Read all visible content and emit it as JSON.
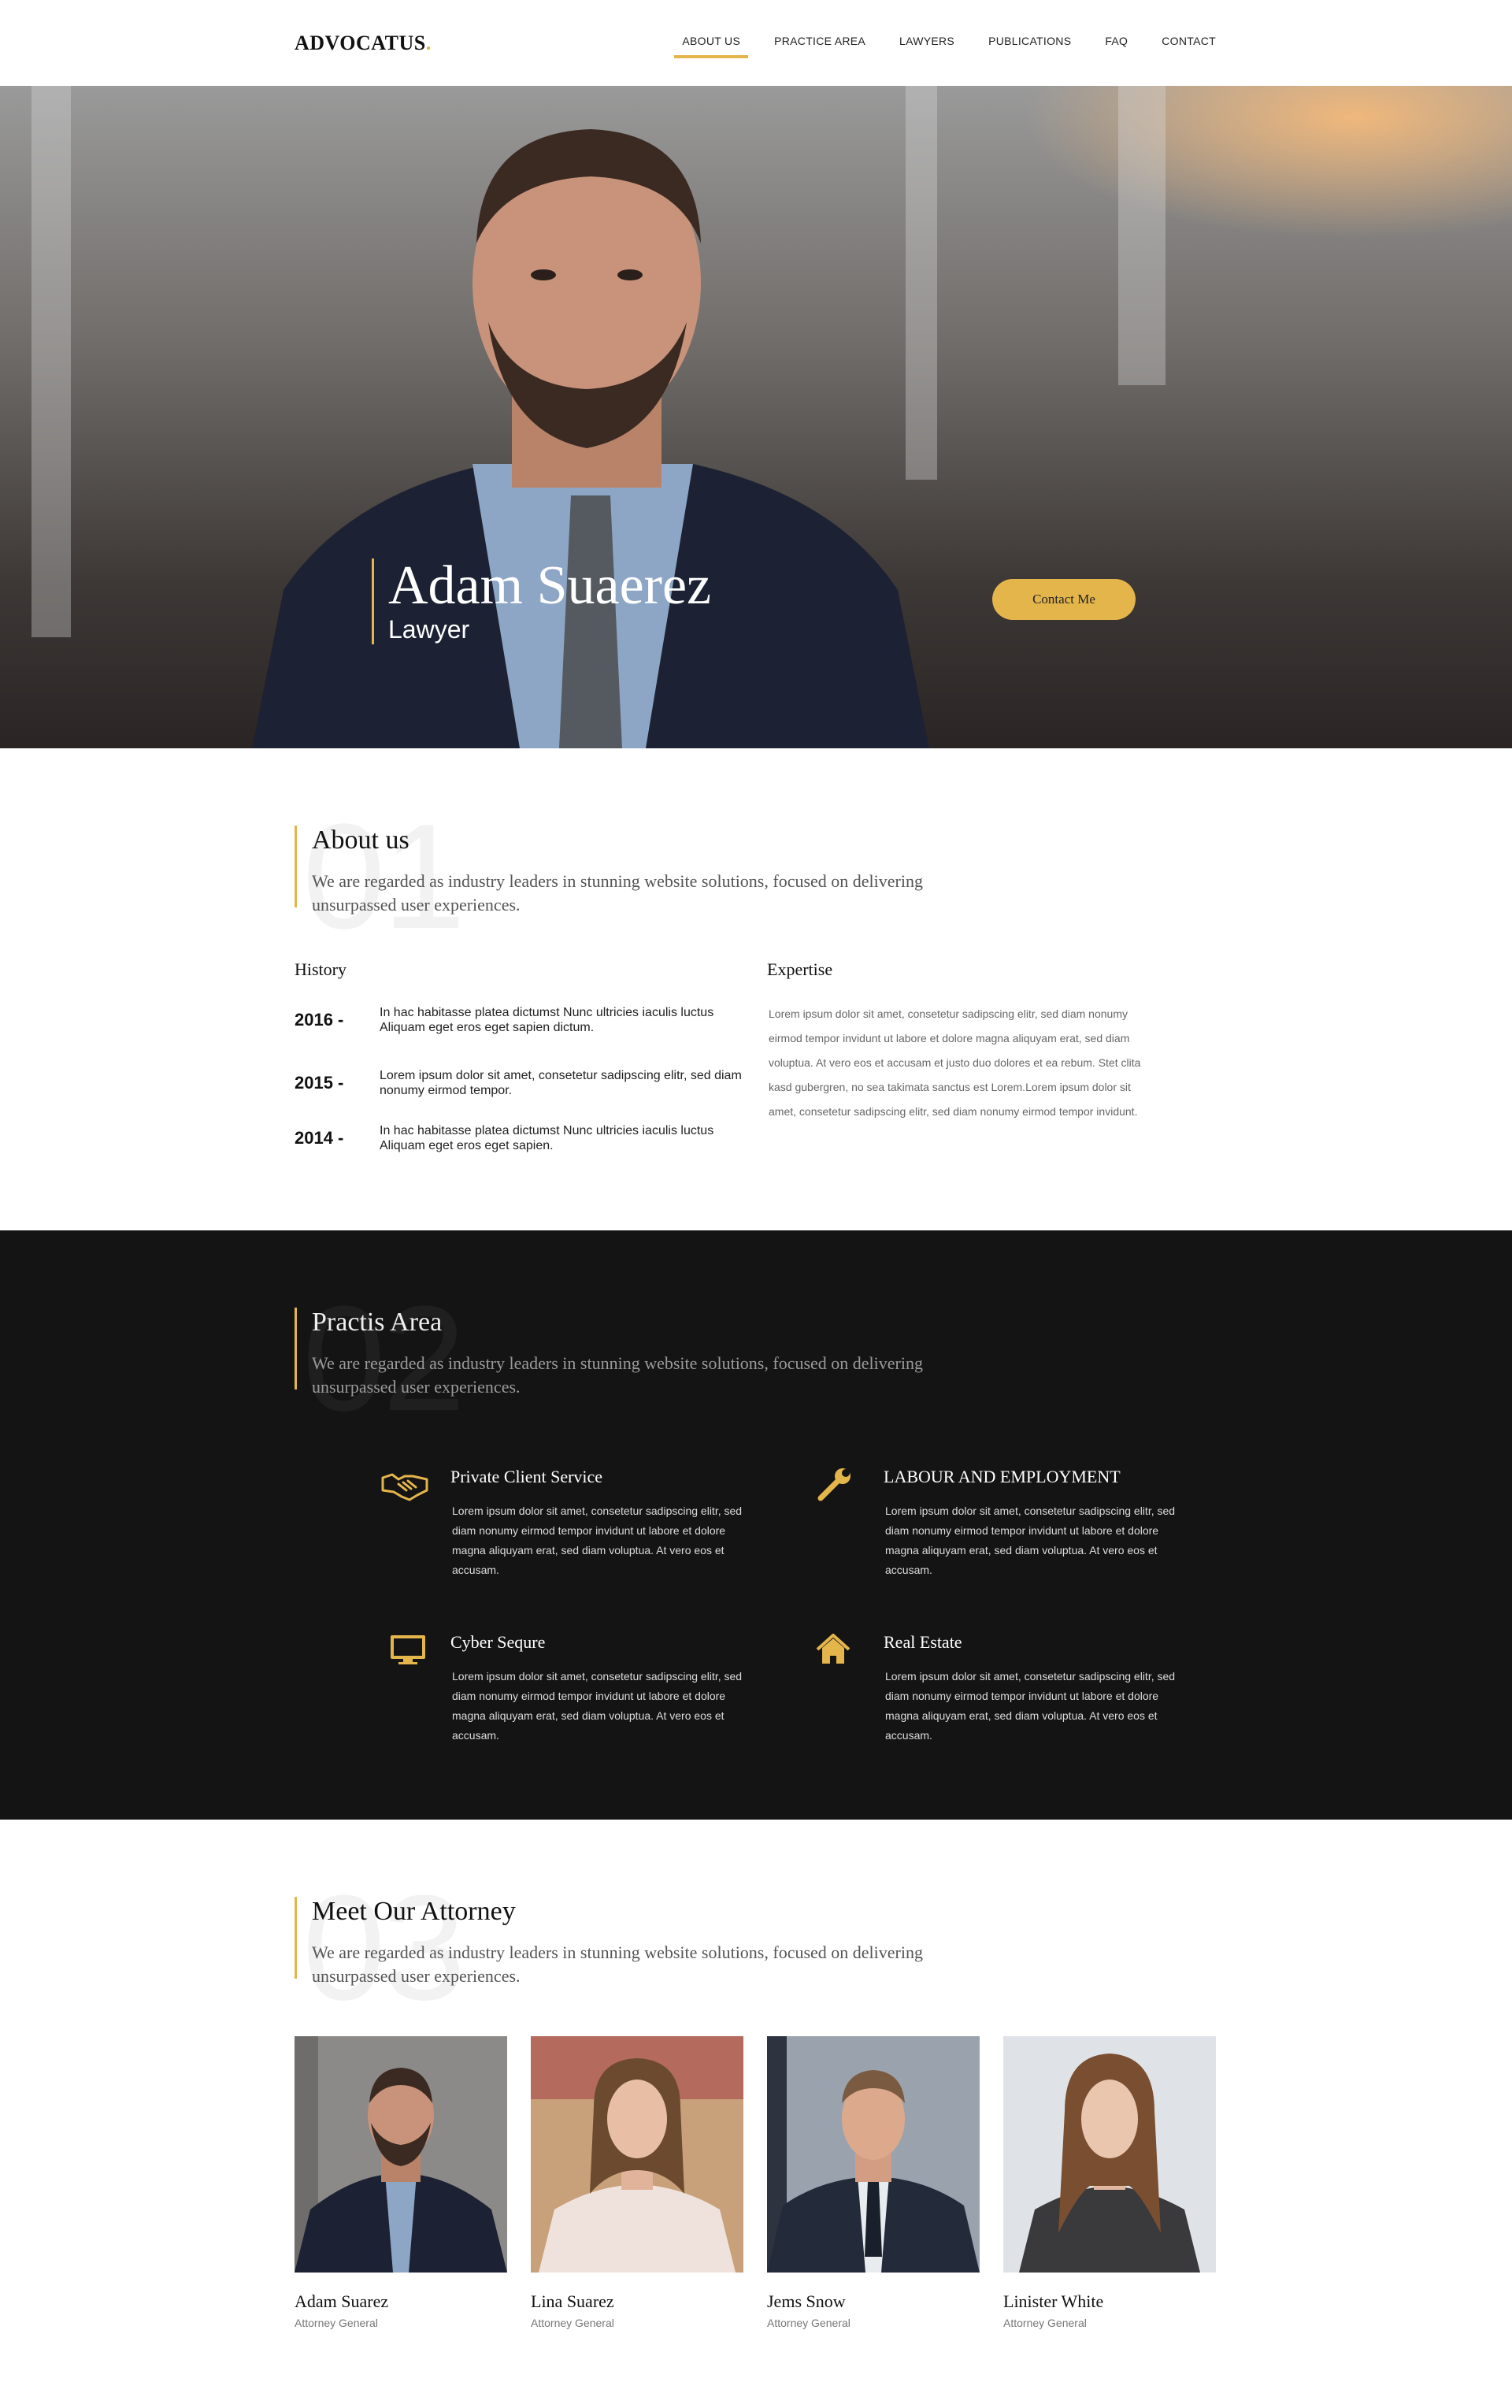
{
  "brand": {
    "name": "ADVOCATUS",
    "dot": ".",
    "accent": "#e4b54b"
  },
  "nav": [
    {
      "label": "ABOUT US",
      "active": true
    },
    {
      "label": "PRACTICE AREA"
    },
    {
      "label": "LAWYERS"
    },
    {
      "label": "PUBLICATIONS"
    },
    {
      "label": "FAQ"
    },
    {
      "label": "CONTACT"
    }
  ],
  "hero": {
    "name": "Adam Suaerez",
    "role": "Lawyer",
    "cta": "Contact Me"
  },
  "about": {
    "num": "01",
    "title": "About us",
    "subtitle": "We are regarded as industry leaders in stunning website solutions, focused on delivering unsurpassed user experiences.",
    "history_title": "History",
    "history": [
      {
        "year": "2016 -",
        "text": "In hac habitasse platea dictumst Nunc ultricies iaculis luctus Aliquam eget eros eget sapien dictum."
      },
      {
        "year": "2015 -",
        "text": "Lorem ipsum dolor sit amet, consetetur sadipscing elitr, sed diam nonumy eirmod tempor."
      },
      {
        "year": "2014 -",
        "text": "In hac habitasse platea dictumst Nunc ultricies iaculis luctus Aliquam eget eros eget sapien."
      }
    ],
    "expertise_title": "Expertise",
    "expertise_text": "Lorem ipsum dolor sit amet, consetetur sadipscing elitr, sed diam nonumy eirmod tempor invidunt ut labore et dolore magna aliquyam erat, sed diam voluptua. At vero eos et accusam et justo duo dolores et ea rebum. Stet clita kasd gubergren, no sea takimata sanctus est Lorem.Lorem ipsum dolor sit amet, consetetur sadipscing elitr, sed diam nonumy eirmod tempor invidunt."
  },
  "practice": {
    "num": "02",
    "title": "Practis Area",
    "subtitle": "We are regarded as industry leaders in stunning website solutions, focused on delivering unsurpassed user experiences.",
    "services": [
      {
        "icon": "handshake-icon",
        "title": "Private Client Service",
        "text": "Lorem ipsum dolor sit amet, consetetur sadipscing elitr, sed diam nonumy eirmod tempor invidunt ut labore et dolore magna aliquyam erat, sed diam voluptua. At vero eos et accusam."
      },
      {
        "icon": "wrench-icon",
        "title": "LABOUR AND EMPLOYMENT",
        "text": "Lorem ipsum dolor sit amet, consetetur sadipscing elitr, sed diam nonumy eirmod tempor invidunt ut labore et dolore magna aliquyam erat, sed diam voluptua. At vero eos et accusam."
      },
      {
        "icon": "monitor-icon",
        "title": "Cyber Sequre",
        "text": "Lorem ipsum dolor sit amet, consetetur sadipscing elitr, sed diam nonumy eirmod tempor invidunt ut labore et dolore magna aliquyam erat, sed diam voluptua. At vero eos et accusam."
      },
      {
        "icon": "house-icon",
        "title": "Real Estate",
        "text": "Lorem ipsum dolor sit amet, consetetur sadipscing elitr, sed diam nonumy eirmod tempor invidunt ut labore et dolore magna aliquyam erat, sed diam voluptua. At vero eos et accusam."
      }
    ]
  },
  "attorneys": {
    "num": "03",
    "title": "Meet Our Attorney",
    "subtitle": "We are regarded as industry leaders in stunning website solutions, focused on delivering unsurpassed user experiences.",
    "people": [
      {
        "name": "Adam Suarez",
        "role": "Attorney General"
      },
      {
        "name": "Lina Suarez",
        "role": "Attorney General"
      },
      {
        "name": "Jems Snow",
        "role": "Attorney General"
      },
      {
        "name": "Linister White",
        "role": "Attorney General"
      }
    ]
  }
}
